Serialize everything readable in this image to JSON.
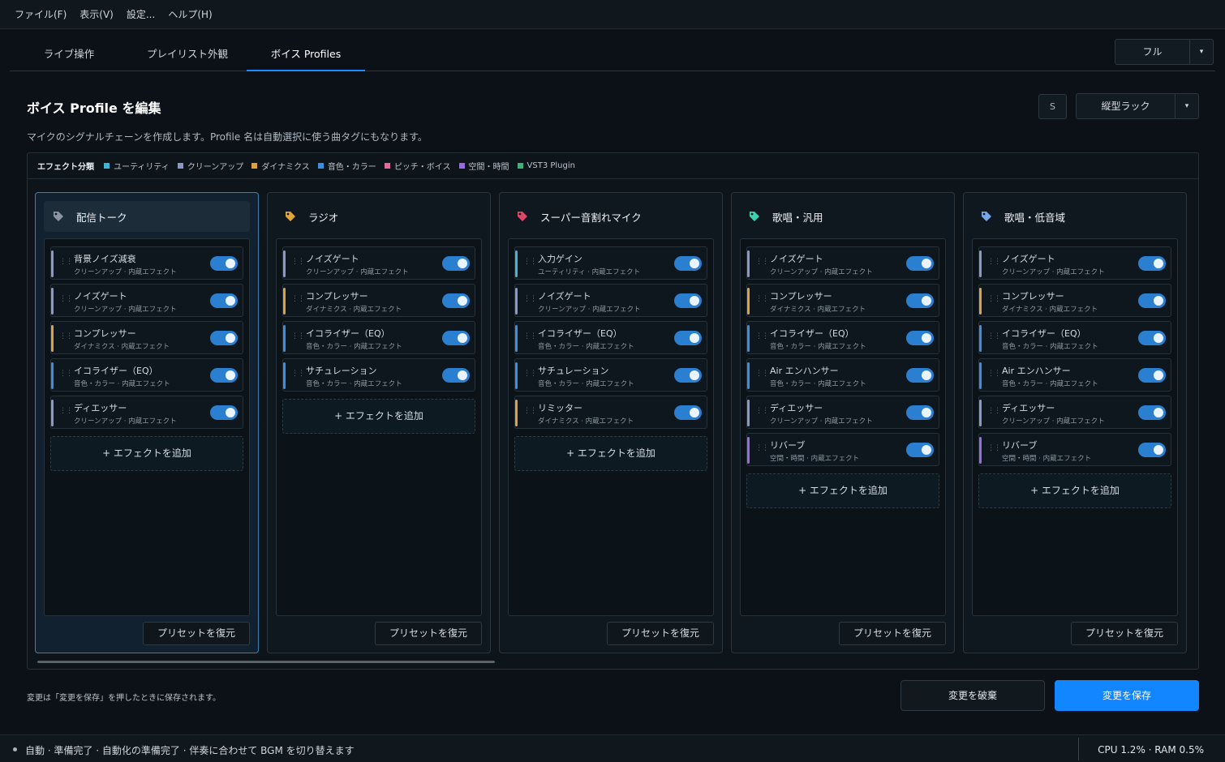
{
  "menu": [
    "ファイル(F)",
    "表示(V)",
    "設定...",
    "ヘルプ(H)"
  ],
  "tabs": [
    {
      "label": "ライブ操作",
      "active": false
    },
    {
      "label": "プレイリスト外観",
      "active": false
    },
    {
      "label": "ボイス Profiles",
      "active": true
    }
  ],
  "view_mode": {
    "label": "フル",
    "arrow": "▾"
  },
  "page": {
    "title": "ボイス Profile を編集",
    "subtitle": "マイクのシグナルチェーンを作成します。Profile 名は自動選択に使う曲タグにもなります。",
    "s_button": "S",
    "layout_select": "縦型ラック",
    "layout_arrow": "▾"
  },
  "legend": {
    "title": "エフェクト分類",
    "items": [
      {
        "label": "ユーティリティ",
        "color": "#3fb6d8"
      },
      {
        "label": "クリーンアップ",
        "color": "#8e96c8"
      },
      {
        "label": "ダイナミクス",
        "color": "#e0a040"
      },
      {
        "label": "音色・カラー",
        "color": "#3a8fe0"
      },
      {
        "label": "ピッチ・ボイス",
        "color": "#e06a9a"
      },
      {
        "label": "空間・時間",
        "color": "#9a6ae0"
      },
      {
        "label": "VST3 Plugin",
        "color": "#3fb07a"
      }
    ]
  },
  "profiles": [
    {
      "name": "配信トーク",
      "tag_color": "#8a96a3",
      "selected": true,
      "effects": [
        {
          "name": "背景ノイズ減衰",
          "sub": "クリーンアップ · 内蔵エフェクト",
          "color": "#8e96c8",
          "on": true
        },
        {
          "name": "ノイズゲート",
          "sub": "クリーンアップ · 内蔵エフェクト",
          "color": "#8e96c8",
          "on": true
        },
        {
          "name": "コンプレッサー",
          "sub": "ダイナミクス · 内蔵エフェクト",
          "color": "#e0a040",
          "on": true
        },
        {
          "name": "イコライザー（EQ）",
          "sub": "音色・カラー · 内蔵エフェクト",
          "color": "#3a8fe0",
          "on": true
        },
        {
          "name": "ディエッサー",
          "sub": "クリーンアップ · 内蔵エフェクト",
          "color": "#8e96c8",
          "on": true
        }
      ],
      "add_label": "+ エフェクトを追加",
      "restore_label": "プリセットを復元"
    },
    {
      "name": "ラジオ",
      "tag_color": "#e0a63a",
      "selected": false,
      "effects": [
        {
          "name": "ノイズゲート",
          "sub": "クリーンアップ · 内蔵エフェクト",
          "color": "#8e96c8",
          "on": true
        },
        {
          "name": "コンプレッサー",
          "sub": "ダイナミクス · 内蔵エフェクト",
          "color": "#e0a040",
          "on": true
        },
        {
          "name": "イコライザー（EQ）",
          "sub": "音色・カラー · 内蔵エフェクト",
          "color": "#3a8fe0",
          "on": true
        },
        {
          "name": "サチュレーション",
          "sub": "音色・カラー · 内蔵エフェクト",
          "color": "#3a8fe0",
          "on": true
        }
      ],
      "add_label": "+ エフェクトを追加",
      "restore_label": "プリセットを復元"
    },
    {
      "name": "スーパー音割れマイク",
      "tag_color": "#e0456a",
      "selected": false,
      "effects": [
        {
          "name": "入力ゲイン",
          "sub": "ユーティリティ · 内蔵エフェクト",
          "color": "#3fb6d8",
          "on": true
        },
        {
          "name": "ノイズゲート",
          "sub": "クリーンアップ · 内蔵エフェクト",
          "color": "#8e96c8",
          "on": true
        },
        {
          "name": "イコライザー（EQ）",
          "sub": "音色・カラー · 内蔵エフェクト",
          "color": "#3a8fe0",
          "on": true
        },
        {
          "name": "サチュレーション",
          "sub": "音色・カラー · 内蔵エフェクト",
          "color": "#3a8fe0",
          "on": true
        },
        {
          "name": "リミッター",
          "sub": "ダイナミクス · 内蔵エフェクト",
          "color": "#e0a040",
          "on": true
        }
      ],
      "add_label": "+ エフェクトを追加",
      "restore_label": "プリセットを復元"
    },
    {
      "name": "歌唱・汎用",
      "tag_color": "#3fd0b0",
      "selected": false,
      "effects": [
        {
          "name": "ノイズゲート",
          "sub": "クリーンアップ · 内蔵エフェクト",
          "color": "#8e96c8",
          "on": true
        },
        {
          "name": "コンプレッサー",
          "sub": "ダイナミクス · 内蔵エフェクト",
          "color": "#e0a040",
          "on": true
        },
        {
          "name": "イコライザー（EQ）",
          "sub": "音色・カラー · 内蔵エフェクト",
          "color": "#3a8fe0",
          "on": true
        },
        {
          "name": "Air エンハンサー",
          "sub": "音色・カラー · 内蔵エフェクト",
          "color": "#3a8fe0",
          "on": true
        },
        {
          "name": "ディエッサー",
          "sub": "クリーンアップ · 内蔵エフェクト",
          "color": "#8e96c8",
          "on": true
        },
        {
          "name": "リバーブ",
          "sub": "空間・時間 · 内蔵エフェクト",
          "color": "#9a6ae0",
          "on": true
        }
      ],
      "add_label": "+ エフェクトを追加",
      "restore_label": "プリセットを復元"
    },
    {
      "name": "歌唱・低音域",
      "tag_color": "#7aa6e8",
      "selected": false,
      "effects": [
        {
          "name": "ノイズゲート",
          "sub": "クリーンアップ · 内蔵エフェクト",
          "color": "#8e96c8",
          "on": true
        },
        {
          "name": "コンプレッサー",
          "sub": "ダイナミクス · 内蔵エフェクト",
          "color": "#e0a040",
          "on": true
        },
        {
          "name": "イコライザー（EQ）",
          "sub": "音色・カラー · 内蔵エフェクト",
          "color": "#3a8fe0",
          "on": true
        },
        {
          "name": "Air エンハンサー",
          "sub": "音色・カラー · 内蔵エフェクト",
          "color": "#3a8fe0",
          "on": true
        },
        {
          "name": "ディエッサー",
          "sub": "クリーンアップ · 内蔵エフェクト",
          "color": "#8e96c8",
          "on": true
        },
        {
          "name": "リバーブ",
          "sub": "空間・時間 · 内蔵エフェクト",
          "color": "#9a6ae0",
          "on": true
        }
      ],
      "add_label": "+ エフェクトを追加",
      "restore_label": "プリセットを復元"
    }
  ],
  "footer": {
    "note": "変更は「変更を保存」を押したときに保存されます。",
    "discard_label": "変更を破棄",
    "save_label": "変更を保存"
  },
  "status": {
    "text": "自動 · 準備完了 · 自動化の準備完了 · 伴奏に合わせて BGM を切り替えます",
    "perf": "CPU 1.2% · RAM 0.5%"
  }
}
